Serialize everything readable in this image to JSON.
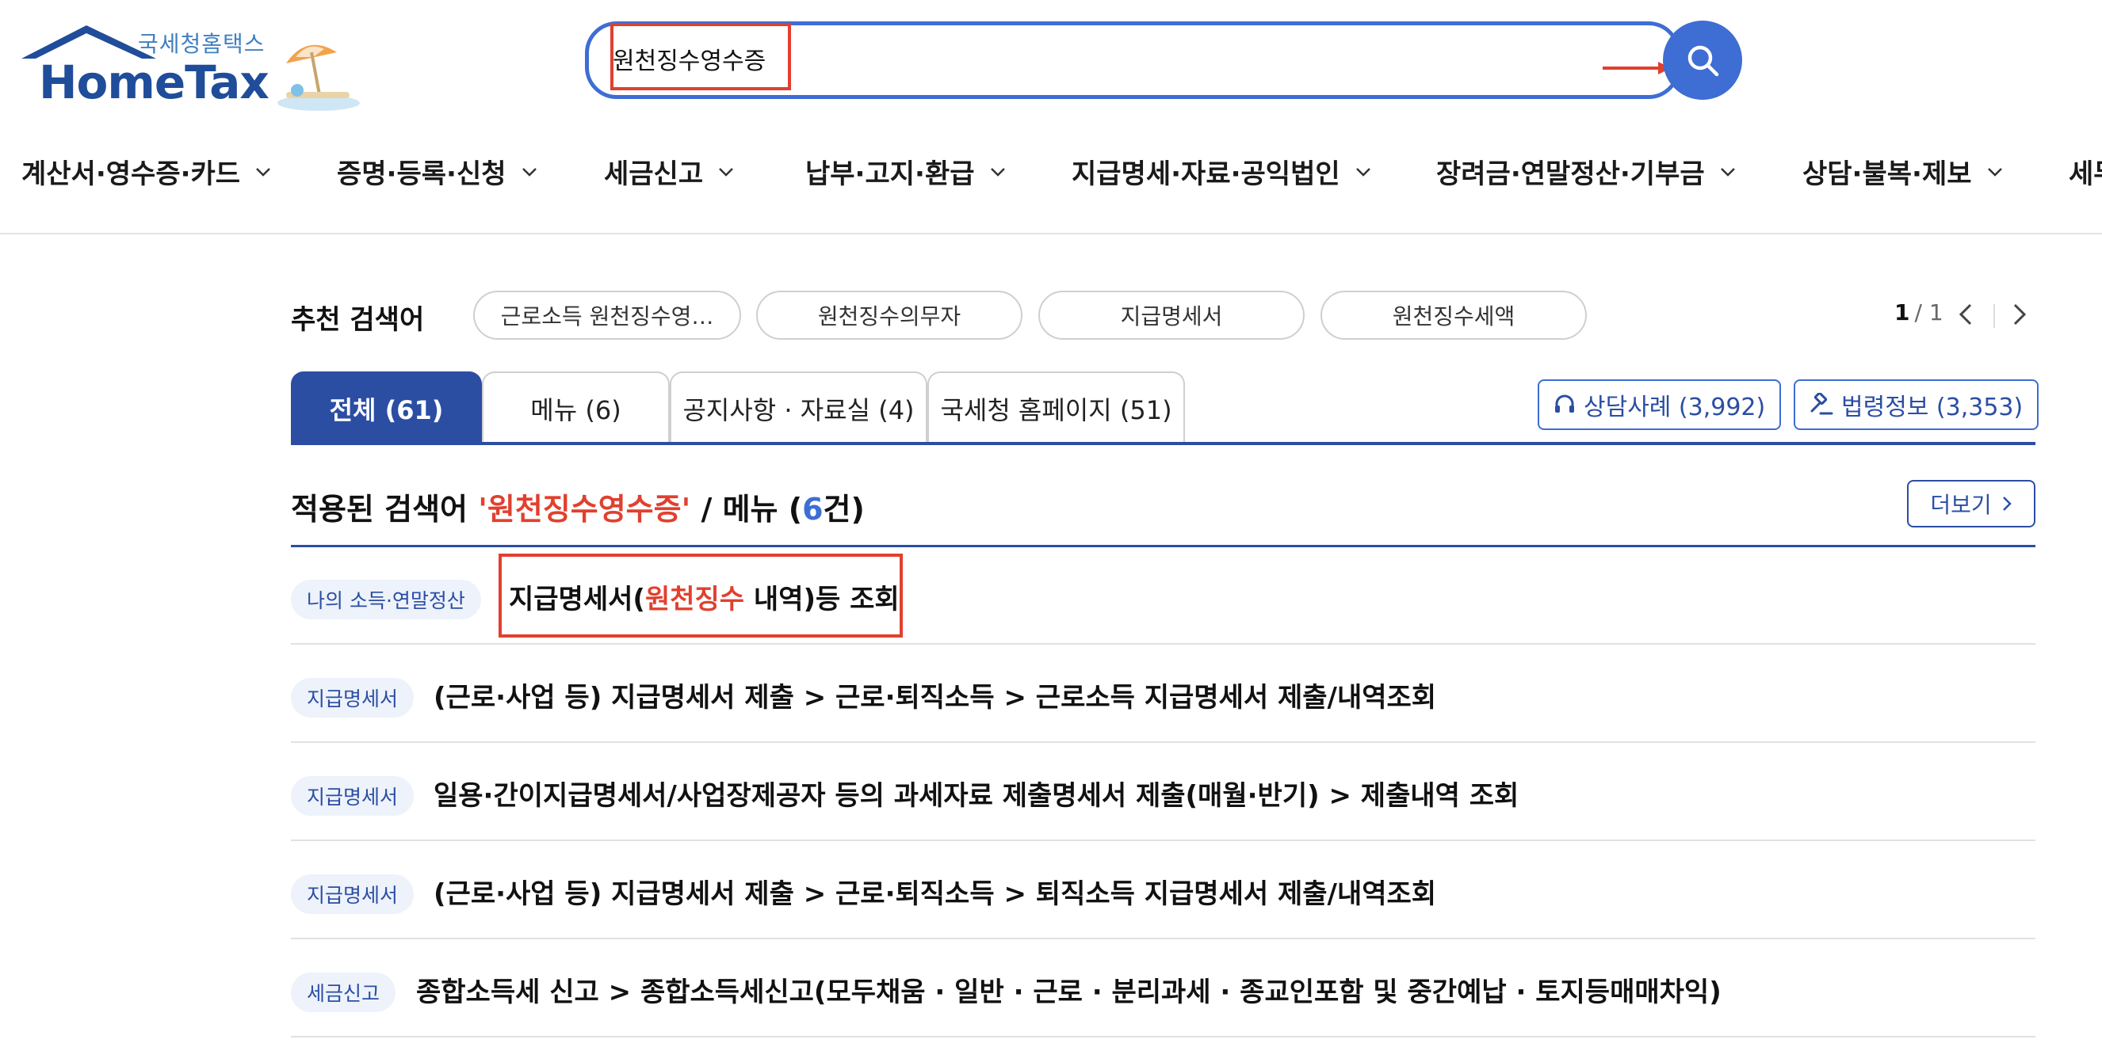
{
  "logo": {
    "subtitle": "국세청홈택스",
    "title": "HomeTax"
  },
  "search": {
    "value": "원천징수영수증"
  },
  "nav": {
    "items": [
      "계산서·영수증·카드",
      "증명·등록·신청",
      "세금신고",
      "납부·고지·환급",
      "지급명세·자료·공익법인",
      "장려금·연말정산·기부금",
      "상담·불복·제보",
      "세무"
    ]
  },
  "recommend": {
    "title": "추천 검색어",
    "chips": [
      "근로소득 원천징수영…",
      "원천징수의무자",
      "지급명세서",
      "원천징수세액"
    ],
    "pager_current": "1",
    "pager_total": "/ 1"
  },
  "tabs": [
    {
      "label": "전체 (61)"
    },
    {
      "label": "메뉴 (6)"
    },
    {
      "label": "공지사항 · 자료실 (4)"
    },
    {
      "label": "국세청 홈페이지 (51)"
    }
  ],
  "side_buttons": {
    "consult": "상담사례 (3,992)",
    "law": "법령정보 (3,353)"
  },
  "applied": {
    "prefix": "적용된 검색어 ",
    "keyword": "'원천징수영수증'",
    "middle": " / 메뉴 (",
    "count": "6",
    "suffix": "건)",
    "more": "더보기"
  },
  "results": [
    {
      "tag": "나의 소득·연말정산",
      "title_pre": "지급명세서(",
      "title_hl": "원천징수",
      "title_post": " 내역)등 조회"
    },
    {
      "tag": "지급명세서",
      "title_pre": "(근로·사업 등) 지급명세서 제출 > 근로·퇴직소득 > 근로소득 지급명세서 제출/내역조회",
      "title_hl": "",
      "title_post": ""
    },
    {
      "tag": "지급명세서",
      "title_pre": "일용·간이지급명세서/사업장제공자 등의 과세자료 제출명세서 제출(매월·반기) > 제출내역 조회",
      "title_hl": "",
      "title_post": ""
    },
    {
      "tag": "지급명세서",
      "title_pre": "(근로·사업 등) 지급명세서 제출 > 근로·퇴직소득 > 퇴직소득 지급명세서 제출/내역조회",
      "title_hl": "",
      "title_post": ""
    },
    {
      "tag": "세금신고",
      "title_pre": "종합소득세 신고 > 종합소득세신고(모두채움 · 일반 · 근로 · 분리과세 · 종교인포함 및 중간예납 · 토지등매매차익)",
      "title_hl": "",
      "title_post": ""
    }
  ],
  "colors": {
    "brand": "#1f4d9a",
    "accent": "#3e6dd3",
    "tab_active": "#2b4ea3",
    "highlight": "#e1402f"
  }
}
